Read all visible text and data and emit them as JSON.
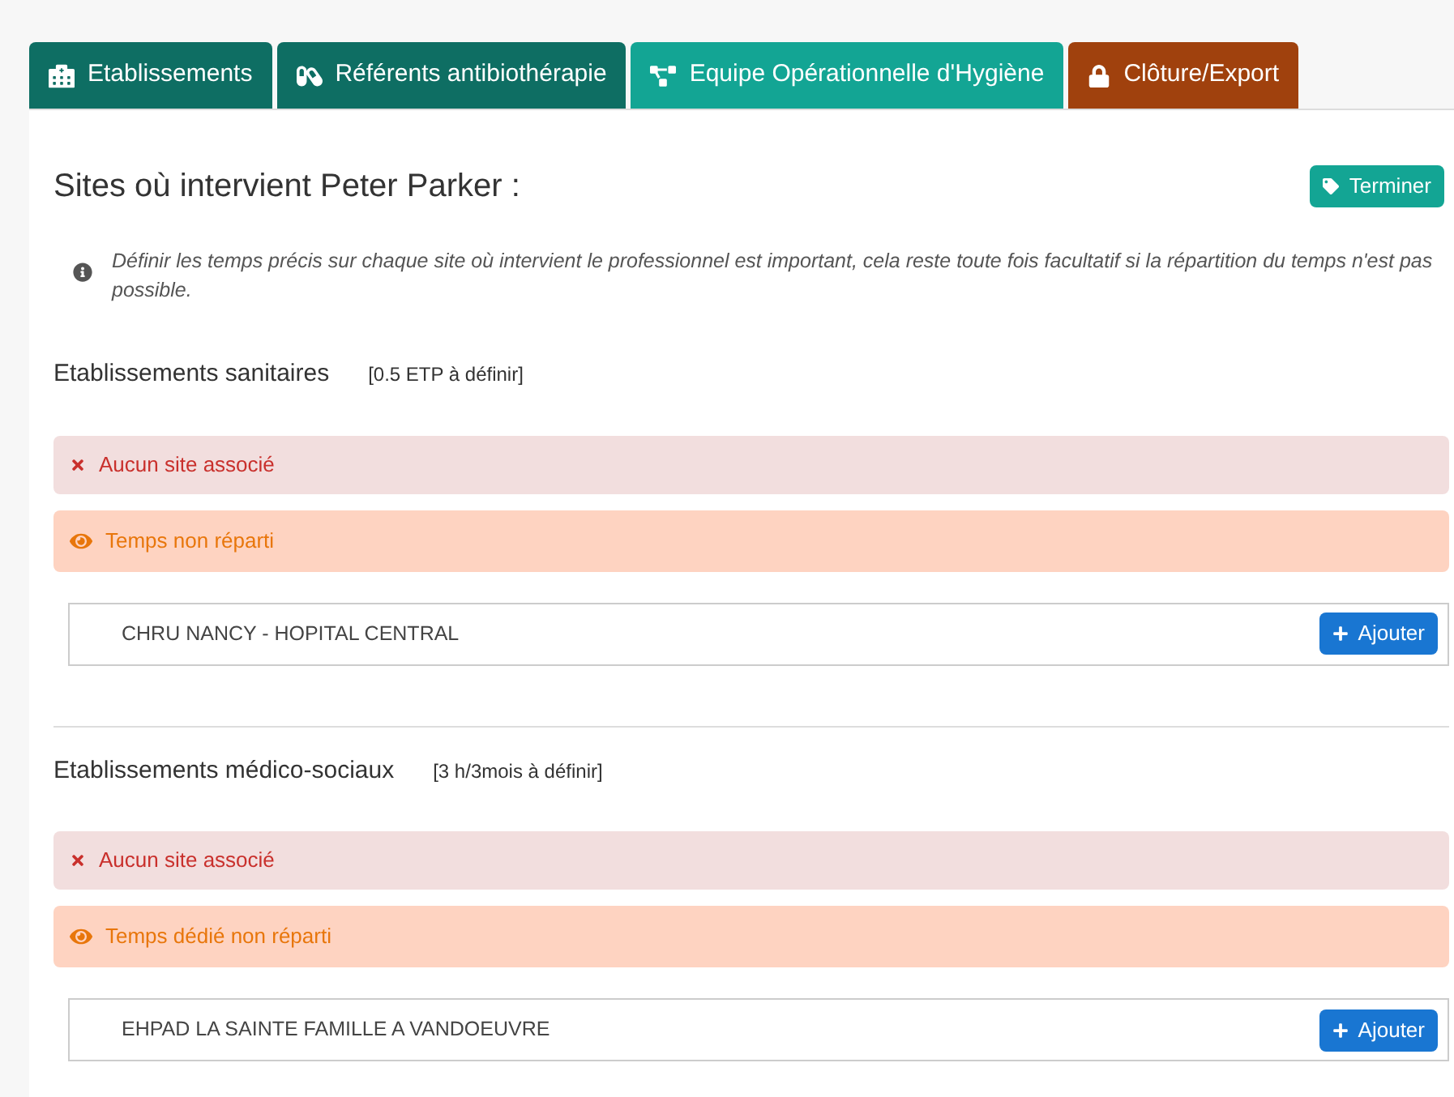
{
  "tabs": [
    {
      "label": "Etablissements",
      "color": "#0e6e63"
    },
    {
      "label": "Référents antibiothérapie",
      "color": "#0e6e63"
    },
    {
      "label": "Equipe Opérationnelle d'Hygiène",
      "color": "#13a594"
    },
    {
      "label": "Clôture/Export",
      "color": "#a0410d"
    }
  ],
  "title": "Sites où intervient Peter Parker :",
  "finish_button": "Terminer",
  "info": "Définir les temps précis sur chaque site où intervient le professionnel est important, cela reste toute fois facultatif si la répartition du temps n'est pas possible.",
  "sections": [
    {
      "title": "Etablissements sanitaires",
      "quota": "[0.5 ETP à définir]",
      "alerts": [
        {
          "kind": "error",
          "text": "Aucun site associé"
        },
        {
          "kind": "warning",
          "text": "Temps non réparti"
        }
      ],
      "site": "CHRU NANCY - HOPITAL CENTRAL",
      "button": "Ajouter"
    },
    {
      "title": "Etablissements médico-sociaux",
      "quota": "[3 h/3mois à définir]",
      "alerts": [
        {
          "kind": "error",
          "text": "Aucun site associé"
        },
        {
          "kind": "warning",
          "text": "Temps dédié non réparti"
        }
      ],
      "site": "EHPAD LA SAINTE FAMILLE A VANDOEUVRE",
      "button": "Ajouter"
    }
  ]
}
